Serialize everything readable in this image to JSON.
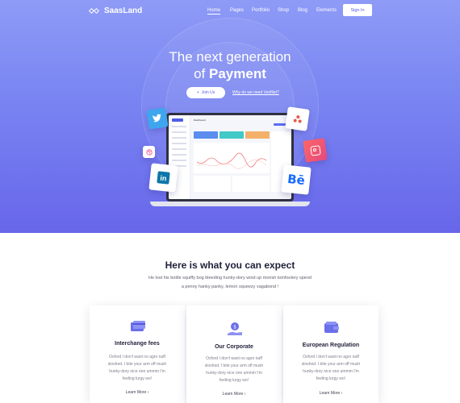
{
  "brand": {
    "name": "SaasLand"
  },
  "nav": {
    "items": [
      "Home",
      "Pages",
      "Portfolio",
      "Shop",
      "Blog",
      "Elements"
    ],
    "active": "Home",
    "signin_label": "Sign In"
  },
  "hero": {
    "title_line1": "The next generation",
    "title_line2_prefix": "of",
    "title_line2_bold": "Payment",
    "join_label": "Join Us",
    "why_label": "Why do we need Verifliet?"
  },
  "dashboard": {
    "title": "Dashboard"
  },
  "social_badges": [
    "twitter-icon",
    "linkedin-icon",
    "behance-icon",
    "instagram-icon",
    "dribbble-icon",
    "gitbook-icon"
  ],
  "features_section": {
    "title": "Here is what you can expect",
    "description_line1": "He lost his bottle squiffy bog bleeding hunky-dory wind up morish tomfoolery spend",
    "description_line2": "a penny hanky panky, lemon squeezy vagabond !"
  },
  "features": [
    {
      "title": "Interchange fees",
      "text_lines": [
        "Oxford I don't want no agro naff",
        "sloshed. I bite your arm off mush",
        "hunky-dory nice one ummm I'm",
        "feeling lurgy wo!"
      ],
      "link": "Learn More"
    },
    {
      "title": "Our Corporate",
      "text_lines": [
        "Oxford I don't want no agro naff",
        "sloshed. I bite your arm off mush",
        "hunky-dory nice one ummm I'm",
        "feeling lurgy wo!"
      ],
      "link": "Learn More"
    },
    {
      "title": "European Regulation",
      "text_lines": [
        "Oxford I don't want no agro naff",
        "sloshed. I bite your arm off mush",
        "hunky-dory nice one ummm I'm",
        "feeling lurgy wo!"
      ],
      "link": "Learn More"
    }
  ],
  "colors": {
    "accent": "#5a5ce8",
    "hero_top": "#8e9bf6",
    "hero_bottom": "#6766ea"
  }
}
